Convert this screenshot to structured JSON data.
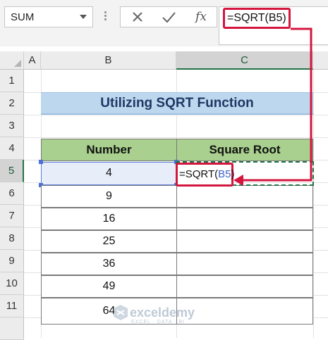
{
  "name_box": {
    "value": "SUM"
  },
  "formula_bar": {
    "cancel_icon": "close-icon",
    "enter_icon": "check-icon",
    "function_label": "fx",
    "content": "=SQRT(B5)"
  },
  "columns": [
    "A",
    "B",
    "C"
  ],
  "rows": [
    "1",
    "2",
    "3",
    "4",
    "5",
    "6",
    "7",
    "8",
    "9",
    "10",
    "11"
  ],
  "active_cell": {
    "column": "C",
    "row": "5"
  },
  "sheet": {
    "title": "Utilizing SQRT Function",
    "table_headers": [
      "Number",
      "Square Root"
    ],
    "numbers": [
      "4",
      "9",
      "16",
      "25",
      "36",
      "49",
      "64"
    ],
    "editing": {
      "prefix": "=SQRT(",
      "ref": "B5",
      "suffix": ")"
    }
  },
  "watermark": {
    "name": "exceldemy",
    "tagline": "EXCEL · DATA · BI"
  },
  "colors": {
    "accent": "#217346",
    "highlight": "#d4163f",
    "header_fill": "#a9d08e",
    "title_fill": "#bdd7ee"
  }
}
